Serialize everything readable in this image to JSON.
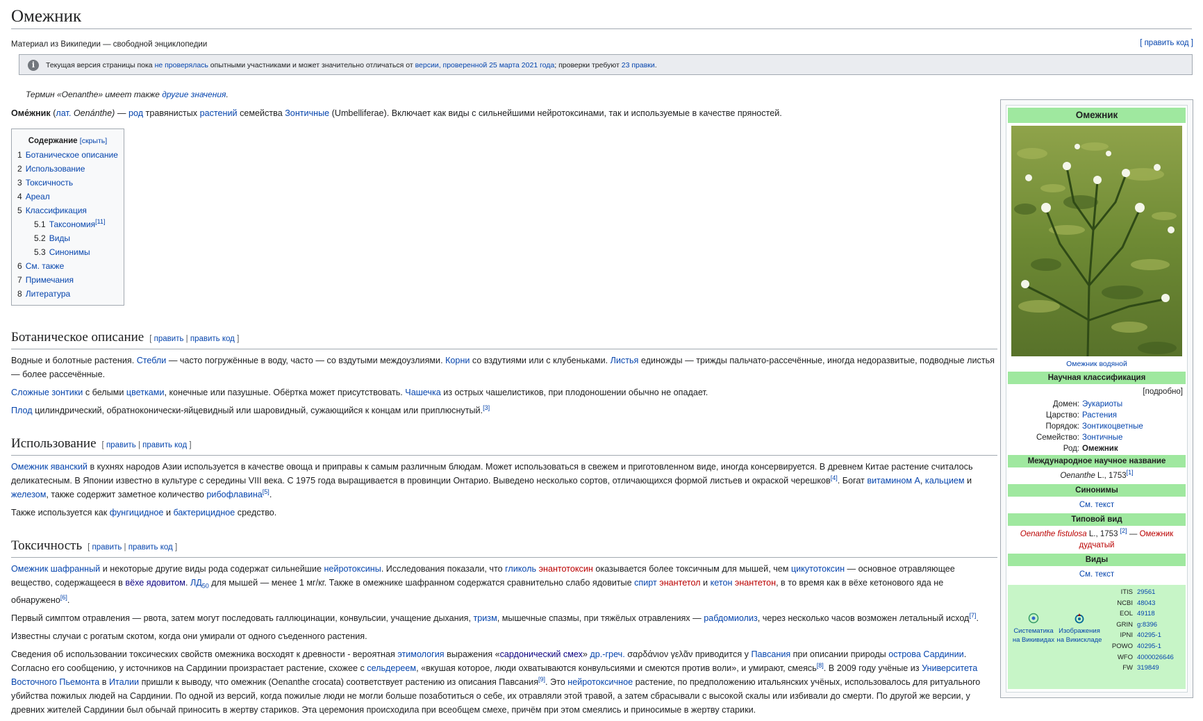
{
  "page": {
    "title": "Омежник",
    "tagline": "Материал из Википедии — свободной энциклопедии",
    "edit_code": "[ править код ]"
  },
  "notice": {
    "t1": "Текущая версия страницы пока ",
    "l1": "не проверялась",
    "t2": " опытными участниками и может значительно отличаться от ",
    "l2": "версии, проверенной 25 марта 2021 года",
    "t3": "; проверки требуют ",
    "l3": "23 правки",
    "t4": "."
  },
  "hatnote": {
    "t1": "Термин «Oenanthe» имеет также ",
    "l1": "другие значения",
    "t2": "."
  },
  "lead": {
    "b": "Оме́жник",
    "t1": " (",
    "l_lat": "лат.",
    "t2": " Oenánthe) — ",
    "l_rod": "род",
    "t3": " травянистых ",
    "l_rast": "растений",
    "t4": " семейства ",
    "l_zont": "Зонтичные",
    "t5": " (Umbelliferae). Включает как виды с сильнейшими нейротоксинами, так и используемые в качестве пряностей."
  },
  "toc": {
    "heading": "Содержание",
    "toggle": "[скрыть]",
    "items": [
      {
        "num": "1",
        "label": "Ботаническое описание"
      },
      {
        "num": "2",
        "label": "Использование"
      },
      {
        "num": "3",
        "label": "Токсичность"
      },
      {
        "num": "4",
        "label": "Ареал"
      },
      {
        "num": "5",
        "label": "Классификация"
      },
      {
        "num": "5.1",
        "label": "Таксономия",
        "sup": "[11]"
      },
      {
        "num": "5.2",
        "label": "Виды"
      },
      {
        "num": "5.3",
        "label": "Синонимы"
      },
      {
        "num": "6",
        "label": "См. также"
      },
      {
        "num": "7",
        "label": "Примечания"
      },
      {
        "num": "8",
        "label": "Литература"
      }
    ]
  },
  "edit": {
    "lb": "[ ",
    "pr": "править",
    "sep": " | ",
    "prk": "править код",
    "rb": " ]"
  },
  "bot": {
    "h": "Ботаническое описание",
    "p1": {
      "t1": "Водные и болотные растения. ",
      "l1": "Стебли",
      "t2": " — часто погружённые в воду, часто — со вздутыми междоузлиями. ",
      "l2": "Корни",
      "t3": " со вздутиями или с клубеньками. ",
      "l3": "Листья",
      "t4": " единожды — трижды пальчато-рассечённые, иногда недоразвитые, подводные листья — более рассечённые."
    },
    "p2": {
      "l1": "Сложные зонтики",
      "t1": " с белыми ",
      "l2": "цветками",
      "t2": ", конечные или пазушные. Обёртка может присутствовать. ",
      "l3": "Чашечка",
      "t3": " из острых чашелистиков, при плодоношении обычно не опадает."
    },
    "p3": {
      "l1": "Плод",
      "t1": " цилиндрический, обратноконически-яйцевидный или шаровидный, сужающийся к концам или приплюснутый.",
      "s1": "[3]"
    }
  },
  "use": {
    "h": "Использование",
    "p1": {
      "l1": "Омежник яванский",
      "t1": " в кухнях народов Азии используется в качестве овоща и приправы к самым различным блюдам. Может использоваться в свежем и приготовленном виде, иногда консервируется. В древнем Китае растение считалось деликатесным. В Японии известно в культуре с середины VIII века. С 1975 года выращивается в провинции Онтарио. Выведено несколько сортов, отличающихся формой листьев и окраской черешков",
      "s1": "[4]",
      "t2": ". Богат ",
      "l2": "витамином A",
      "t3": ", ",
      "l3": "кальцием",
      "t4": " и ",
      "l4": "железом",
      "t5": ", также содержит заметное количество ",
      "l5": "рибофлавина",
      "s2": "[5]",
      "t6": "."
    },
    "p2": {
      "t1": "Также используется как ",
      "l1": "фунгицидное",
      "t2": " и ",
      "l2": "бактерицидное",
      "t3": " средство."
    }
  },
  "tox": {
    "h": "Токсичность",
    "p1": {
      "l1": "Омежник шафранный",
      "t1": " и некоторые другие виды рода содержат сильнейшие ",
      "l2": "нейротоксины",
      "t2": ". Исследования показали, что ",
      "l3": "гликоль",
      "t3": " ",
      "r1": "энантотоксин",
      "t4": " оказывается более токсичным для мышей, чем ",
      "l4": "цикутотоксин",
      "t5": " — основное отравляющее вещество, содержащееся в ",
      "v1": "вёхе ядовитом",
      "t6": ". ",
      "l5": "ЛД",
      "l5sub": "50",
      "t7": " для мышей — менее 1 мг/кг. Также в омежнике шафранном содержатся сравнительно слабо ядовитые ",
      "l6": "спирт",
      "t8": " ",
      "r2": "энантетол",
      "t9": " и ",
      "l7": "кетон",
      "t10": " ",
      "r3": "энантетон",
      "t11": ", в то время как в вёхе кетонового яда не обнаружено",
      "s1": "[6]",
      "t12": "."
    },
    "p2": {
      "t1": "Первый симптом отравления — рвота, затем могут последовать галлюцинации, конвульсии, учащение дыхания, ",
      "l1": "тризм",
      "t2": ", мышечные спазмы, при тяжёлых отравлениях — ",
      "l2": "рабдомиолиз",
      "t3": ", через несколько часов возможен летальный исход",
      "s1": "[7]",
      "t4": "."
    },
    "p3": "Известны случаи с рогатым скотом, когда они умирали от одного съеденного растения.",
    "p4": {
      "t1": "Сведения об использовании токсических свойств омежника восходят к древности - вероятная ",
      "l1": "этимология",
      "t2": " выражения «",
      "v1": "сардонический смех",
      "t3": "» ",
      "l2": "др.-греч.",
      "t4": " σαρδάνιον γελᾶν приводится у ",
      "l3": "Павсания",
      "t5": " при описании природы ",
      "l4": "острова Сардинии",
      "t6": ". Согласно его сообщению, у источников на Сардинии произрастает растение, схожее с ",
      "l5": "сельдереем",
      "t7": ", «вкушая которое, люди охватываются конвульсиями и смеются против воли», и умирают, смеясь",
      "s1": "[8]",
      "t8": ". В 2009 году учёные из ",
      "l6": "Университета Восточного Пьемонта",
      "t9": " в ",
      "l7": "Италии",
      "t10": " пришли к выводу, что омежник (Oenanthe crocata) соответствует растению из описания Павсания",
      "s2": "[9]",
      "t11": ". Это ",
      "l8": "нейротоксичное",
      "t12": " растение, по предположению итальянских учёных, использовалось для ритуального убийства пожилых людей на Сардинии. По одной из версий, когда пожилые люди не могли больше позаботиться о себе, их отравляли этой травой, а затем сбрасывали с высокой скалы или избивали до смерти. По другой же версии, у древних жителей Сардинии был обычай приносить в жертву стариков. Эта церемония происходила при всеобщем смехе, причём при этом смеялись и приносимые в жертву старики."
    }
  },
  "infobox": {
    "title": "Омежник",
    "caption": "Омежник водяной",
    "sci_header": "Научная классификация",
    "more": "[подробно]",
    "rows": [
      {
        "k": "Домен:",
        "v": "Эукариоты"
      },
      {
        "k": "Царство:",
        "v": "Растения"
      },
      {
        "k": "Порядок:",
        "v": "Зонтикоцветные"
      },
      {
        "k": "Семейство:",
        "v": "Зонтичные"
      },
      {
        "k": "Род:",
        "v": "Омежник"
      }
    ],
    "intl_header": "Международное научное название",
    "intl_name": "Oenanthe",
    "intl_auth": " L., 1753",
    "intl_sup": "[1]",
    "syn_header": "Синонимы",
    "syn_link": "См. текст",
    "type_header": "Типовой вид",
    "type_name": "Oenanthe fistulosa",
    "type_auth": " L., 1753 ",
    "type_sup": "[2]",
    "type_dash": " — ",
    "type_ru": "Омежник дудчатый",
    "species_header": "Виды",
    "species_link": "См. текст",
    "proj1": "Систематика на Викивидах",
    "proj2": "Изображения на Викискладе",
    "ids": [
      {
        "k": "ITIS",
        "v": "29561"
      },
      {
        "k": "NCBI",
        "v": "48043"
      },
      {
        "k": "EOL",
        "v": "49118"
      },
      {
        "k": "GRIN",
        "v": "g:8396"
      },
      {
        "k": "IPNI",
        "v": "40295-1"
      },
      {
        "k": "POWO",
        "v": "40295-1"
      },
      {
        "k": "WFO",
        "v": "4000026646"
      },
      {
        "k": "FW",
        "v": "319849"
      }
    ]
  },
  "colors": {
    "link": "#0645ad",
    "redlink": "#ba0000",
    "infobox_header": "#9fe89f",
    "infobox_links_bg": "#c7f5c7"
  }
}
